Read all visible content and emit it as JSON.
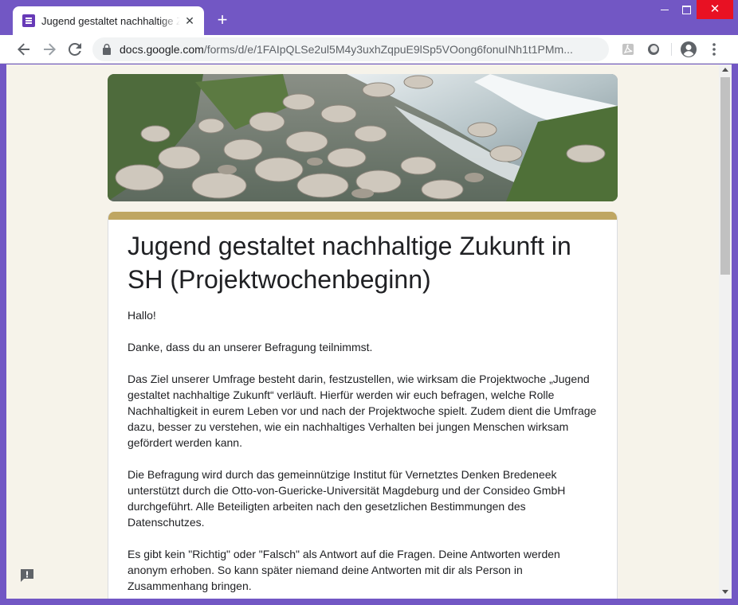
{
  "browser": {
    "tab_title": "Jugend gestaltet nachhaltige Zukunft in SH (Projektwochenbeginn)",
    "tab_close": "✕",
    "new_tab": "+",
    "url_host": "docs.google.com",
    "url_path": "/forms/d/e/1FAIpQLSe2ul5M4y3uxhZqpuE9lSp5VOong6fonuINh1t1PMm..."
  },
  "form": {
    "title": "Jugend gestaltet nachhaltige Zukunft in SH (Projektwochenbeginn)",
    "description": [
      "Hallo!",
      "Danke, dass du an unserer Befragung teilnimmst.",
      "Das Ziel unserer Umfrage besteht darin, festzustellen, wie wirksam die Projektwoche „Jugend gestaltet nachhaltige Zukunft“ verläuft. Hierfür werden wir euch befragen, welche Rolle Nachhaltigkeit in eurem Leben vor und nach der Projektwoche spielt. Zudem dient die Umfrage dazu, besser zu verstehen, wie ein nachhaltiges Verhalten bei jungen Menschen wirksam gefördert werden kann.",
      "Die Befragung wird durch das gemeinnützige Institut für Vernetztes Denken Bredeneek unterstützt durch die Otto-von-Guericke-Universität Magdeburg und der Consideo GmbH durchgeführt. Alle Beteiligten arbeiten nach den gesetzlichen Bestimmungen des Datenschutzes.",
      "Es gibt kein \"Richtig\" oder \"Falsch\" als Antwort auf die Fragen. Deine Antworten werden anonym erhoben. So kann später niemand deine Antworten mit dir als Person in Zusammenhang bringen."
    ]
  },
  "colors": {
    "frame": "#7257c4",
    "page_background": "#f6f3ea",
    "card_accent": "#bfa662",
    "window_close": "#e81123"
  },
  "icons": {
    "tab_favicon": "google-forms-icon",
    "back": "arrow-left-icon",
    "forward": "arrow-right-icon",
    "reload": "reload-icon",
    "lock": "lock-icon",
    "bookmark": "star-icon",
    "extension_1": "pdf-icon",
    "extension_2": "circle-extension-icon",
    "profile": "account-circle-icon",
    "menu": "kebab-menu-icon",
    "feedback": "feedback-icon"
  }
}
